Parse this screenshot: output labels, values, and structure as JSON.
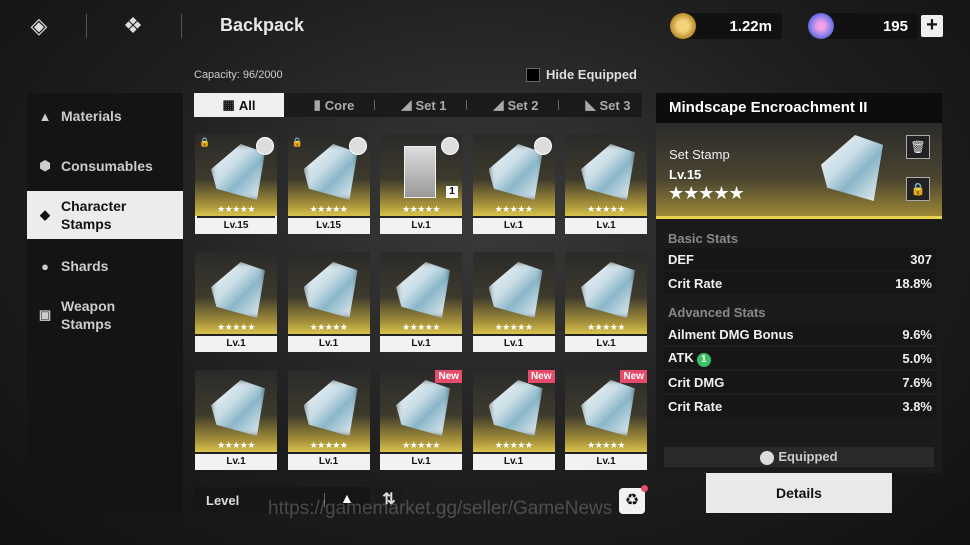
{
  "header": {
    "title": "Backpack",
    "currency_gold": "1.22m",
    "currency_premium": "195",
    "plus_label": "+"
  },
  "capacity": "Capacity: 96/2000",
  "hide_equipped_label": "Hide Equipped",
  "sidebar": {
    "items": [
      {
        "label": "Materials",
        "icon": "flask-icon"
      },
      {
        "label": "Consumables",
        "icon": "hexagon-icon"
      },
      {
        "label": "Character Stamps",
        "icon": "stamp-icon",
        "active": true
      },
      {
        "label": "Shards",
        "icon": "person-icon"
      },
      {
        "label": "Weapon Stamps",
        "icon": "card-icon"
      }
    ]
  },
  "tabs": [
    {
      "label": "All",
      "active": true
    },
    {
      "label": "Core"
    },
    {
      "label": "Set 1"
    },
    {
      "label": "Set 2"
    },
    {
      "label": "Set 3"
    }
  ],
  "grid": {
    "stars": "★★★★★",
    "items": [
      {
        "level": "Lv.15",
        "locked": true,
        "avatar": true,
        "selected": true
      },
      {
        "level": "Lv.15",
        "locked": true,
        "avatar": true
      },
      {
        "level": "Lv.1",
        "avatar": true,
        "photo": true,
        "count": "1"
      },
      {
        "level": "Lv.1",
        "avatar": true
      },
      {
        "level": "Lv.1"
      },
      {
        "level": "Lv.1"
      },
      {
        "level": "Lv.1"
      },
      {
        "level": "Lv.1"
      },
      {
        "level": "Lv.1"
      },
      {
        "level": "Lv.1"
      },
      {
        "level": "Lv.1"
      },
      {
        "level": "Lv.1"
      },
      {
        "level": "Lv.1",
        "new": "New"
      },
      {
        "level": "Lv.1",
        "new": "New"
      },
      {
        "level": "Lv.1",
        "new": "New"
      }
    ]
  },
  "sort": {
    "label": "Level",
    "arrow": "▲",
    "order_icon": "⇅"
  },
  "detail": {
    "title": "Mindscape Encroachment II",
    "type": "Set Stamp",
    "level": "Lv.15",
    "stars": "★★★★★",
    "basic_header": "Basic Stats",
    "basic": [
      {
        "name": "DEF",
        "value": "307"
      },
      {
        "name": "Crit Rate",
        "value": "18.8%"
      }
    ],
    "advanced_header": "Advanced Stats",
    "advanced": [
      {
        "name": "Ailment DMG Bonus",
        "value": "9.6%"
      },
      {
        "name": "ATK",
        "value": "5.0%",
        "badge": "1"
      },
      {
        "name": "Crit DMG",
        "value": "7.6%"
      },
      {
        "name": "Crit Rate",
        "value": "3.8%"
      }
    ],
    "equipped": "Equipped",
    "details_button": "Details"
  },
  "watermark": "https://gamemarket.gg/seller/GameNews",
  "colors": {
    "accent_gold": "#e8d24f",
    "new_tag": "#e54b6a",
    "badge_green": "#3cc060"
  }
}
